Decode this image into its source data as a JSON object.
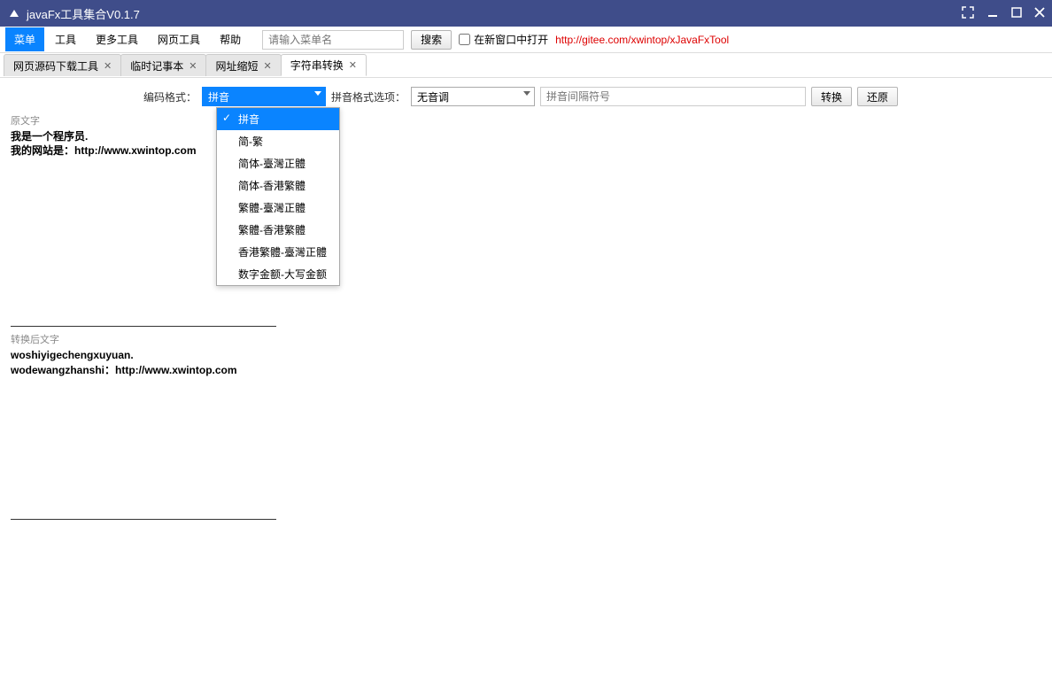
{
  "window": {
    "title": "javaFx工具集合V0.1.7"
  },
  "menubar": {
    "items": [
      "菜单",
      "工具",
      "更多工具",
      "网页工具",
      "帮助"
    ],
    "search_placeholder": "请输入菜单名",
    "search_btn": "搜索",
    "checkbox_label": "在新窗口中打开",
    "link_text": "http://gitee.com/xwintop/xJavaFxTool"
  },
  "tabs": {
    "items": [
      "网页源码下载工具",
      "临时记事本",
      "网址缩短",
      "字符串转换"
    ],
    "active": 3
  },
  "controls": {
    "encoding_label": "编码格式：",
    "encoding_selected": "拼音",
    "encoding_options": [
      "拼音",
      "简-繁",
      "简体-臺灣正體",
      "简体-香港繁體",
      "繁體-臺灣正體",
      "繁體-香港繁體",
      "香港繁體-臺灣正體",
      "数字金额-大写金额"
    ],
    "pinyin_opt_label": "拼音格式选项：",
    "pinyin_opt_selected": "无音调",
    "sep_placeholder": "拼音间隔符号",
    "convert_btn": "转换",
    "restore_btn": "还原"
  },
  "text_sections": {
    "source_label": "原文字",
    "source_text": "我是一个程序员.\n我的网站是：http://www.xwintop.com",
    "result_label": "转换后文字",
    "result_text": "woshiyigechengxuyuan.\nwodewangzhanshi：http://www.xwintop.com"
  }
}
